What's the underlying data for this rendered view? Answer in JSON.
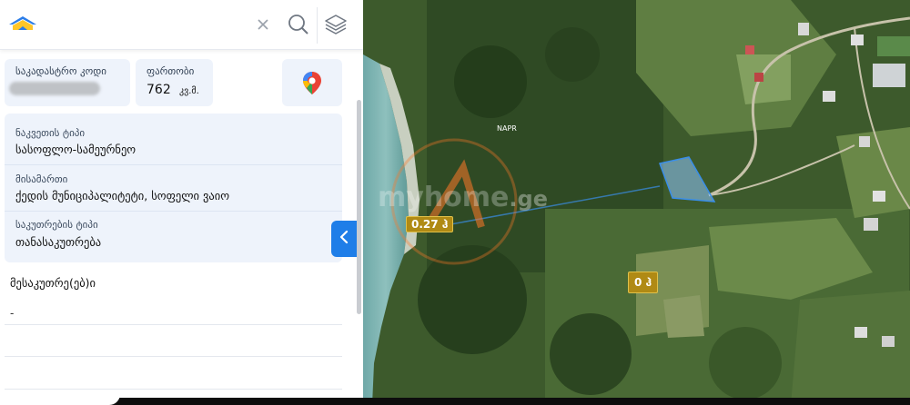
{
  "header": {
    "logo_icon": "myhome-logo-icon",
    "close_icon": "close-icon",
    "search_icon": "search-icon",
    "layers_icon": "layers-icon"
  },
  "cadastral": {
    "code_label": "საკადასტრო კოდი",
    "area_label": "ფართობი",
    "area_value": "762",
    "area_unit": "კვ.მ.",
    "maps_icon": "google-maps-pin-icon"
  },
  "details": {
    "parcel_type_label": "ნაკვეთის ტიპი",
    "parcel_type_value": "სასოფლო-სამეურნეო",
    "address_label": "მისამართი",
    "address_value": "ქედის მუნიციპალიტეტი, სოფელი ვაიო",
    "ownership_label": "საკუთრების ტიპი",
    "ownership_value": "თანასაკუთრება"
  },
  "owners": {
    "title": "მესაკუთრე(ებ)ი",
    "value": "-"
  },
  "map": {
    "watermark": "myhome",
    "watermark_suffix": ".ge",
    "label_napr": "NAPR",
    "tag_1": "0.27 ჰ",
    "tag_2": "0 ჰ",
    "parcel_color": "#8fc7ff",
    "accent_color": "#1f7ee8"
  },
  "panel_toggle_icon": "chevron-left-icon"
}
